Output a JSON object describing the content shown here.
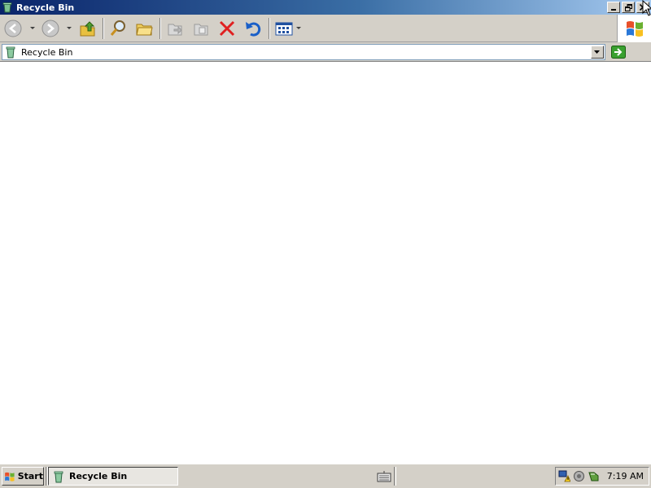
{
  "window": {
    "title": "Recycle Bin",
    "icon": "recycle-bin-icon",
    "controls": [
      "minimize-icon",
      "restore-icon",
      "close-icon"
    ]
  },
  "toolbar": {
    "buttons": [
      {
        "name": "back",
        "icon": "back-arrow-icon"
      },
      {
        "name": "forward",
        "icon": "forward-arrow-icon"
      },
      {
        "name": "up",
        "icon": "folder-up-icon"
      },
      {
        "name": "search",
        "icon": "search-icon"
      },
      {
        "name": "folders",
        "icon": "folders-icon"
      },
      {
        "name": "move-to",
        "icon": "move-to-icon"
      },
      {
        "name": "copy-to",
        "icon": "copy-to-icon"
      },
      {
        "name": "delete",
        "icon": "delete-icon"
      },
      {
        "name": "undo",
        "icon": "undo-icon"
      },
      {
        "name": "views",
        "icon": "views-icon"
      }
    ],
    "brand_icon": "windows-logo-icon",
    "colors": {
      "delete": "#e02020",
      "undo": "#1a5fc8",
      "folder": "#e8c040"
    }
  },
  "address": {
    "value": "Recycle Bin",
    "icon": "recycle-bin-icon",
    "go_icon": "go-arrow-icon"
  },
  "taskbar": {
    "start_label": "Start",
    "task_label": "Recycle Bin",
    "task_icon": "recycle-bin-icon",
    "keyboard_icon": "keyboard-icon",
    "tray_icons": [
      "network-warning-icon",
      "volume-icon",
      "security-icon"
    ],
    "clock": "7:19 AM"
  }
}
